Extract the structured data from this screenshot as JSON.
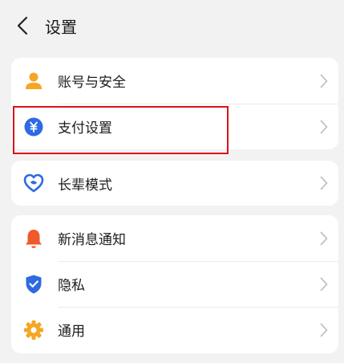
{
  "header": {
    "title": "设置"
  },
  "groups": [
    {
      "items": [
        {
          "label": "账号与安全",
          "icon": "user-icon"
        },
        {
          "label": "支付设置",
          "icon": "yuan-icon"
        }
      ]
    },
    {
      "items": [
        {
          "label": "长辈模式",
          "icon": "heart-icon"
        }
      ]
    },
    {
      "items": [
        {
          "label": "新消息通知",
          "icon": "bell-icon"
        },
        {
          "label": "隐私",
          "icon": "shield-icon"
        },
        {
          "label": "通用",
          "icon": "gear-icon"
        }
      ]
    }
  ],
  "colors": {
    "background": "#f2f2f2",
    "card": "#ffffff",
    "user_icon": "#f5a623",
    "yuan_icon": "#2d6ae3",
    "heart_icon": "#2d6ae3",
    "bell_icon": "#f0592b",
    "shield_icon": "#2d6ae3",
    "gear_icon": "#f5a623",
    "highlight": "#d8141b"
  }
}
